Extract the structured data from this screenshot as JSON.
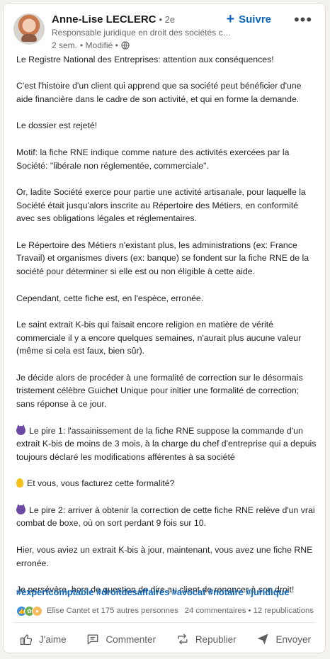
{
  "post": {
    "author_name": "Anne-Lise LECLERC",
    "degree": "• 2e",
    "headline": "Responsable juridique en droit des sociétés chez A...",
    "time": "2 sem.",
    "edited": "• Modifié •",
    "follow_label": "Suivre",
    "more_label": "•••"
  },
  "content": {
    "p1": "Le Registre National des Entreprises: attention aux conséquences!",
    "p2": "C'est l'histoire d'un client qui apprend que sa société peut bénéficier d'une aide financière dans le cadre de son activité, et qui en forme la demande.",
    "p3": "Le dossier est rejeté!",
    "p4": "Motif: la fiche RNE indique comme nature des activités exercées par la Société: \"libérale non réglementée, commerciale\".",
    "p5": "Or, ladite Société exerce pour partie une activité artisanale, pour laquelle la Société était jusqu'alors inscrite au Répertoire des Métiers, en conformité avec ses obligations légales et réglementaires.",
    "p6": "Le Répertoire des Métiers n'existant plus, les administrations (ex: France Travail) et organismes divers (ex: banque) se fondent sur la fiche RNE de la société pour déterminer si elle est ou non éligible à cette aide.",
    "p7": "Cependant, cette fiche est, en l'espèce, erronée.",
    "p8": "Le saint extrait K-bis qui faisait encore religion en matière de vérité commerciale il y a encore quelques semaines, n'aurait plus aucune valeur (même si cela est faux, bien sûr).",
    "p9": "Je décide alors de procéder à une formalité de correction sur le désormais tristement célèbre Guichet Unique pour initier une formalité de correction; sans réponse à ce jour.",
    "p10": "Le pire 1: l'assainissement de la fiche RNE suppose la commande d'un extrait K-bis de moins de 3 mois, à la charge du chef d'entreprise qui a depuis toujours déclaré les modifications afférentes à sa société",
    "p11": "Et vous, vous facturez cette formalité?",
    "p12": "Le pire 2: arriver à obtenir la correction de cette fiche RNE relève d'un vrai combat de boxe, où on sort perdant 9 fois sur 10.",
    "p13": "Hier, vous aviez un extrait K-bis à jour, maintenant, vous avez une fiche RNE erronée.",
    "p14": "Je persévère, hors de question de dire au client de renoncer à son droit!",
    "hashtags": "#expertcomptable #droitdesaffaires #avocat #notaire #juridique"
  },
  "social": {
    "reactors": "Elise Cantet et 175 autres personnes",
    "stats": "24 commentaires • 12 republications"
  },
  "actions": {
    "like": "J'aime",
    "comment": "Commenter",
    "repost": "Republier",
    "send": "Envoyer"
  },
  "colors": {
    "accent": "#0a66c2",
    "background": "#f3f2ef",
    "card": "#ffffff"
  },
  "icons": [
    "globe-icon",
    "plus-icon",
    "more-icon",
    "devil-emoji-icon",
    "bulb-emoji-icon",
    "like-icon",
    "celebrate-icon",
    "insight-icon",
    "thumbs-up-icon",
    "comment-icon",
    "repost-icon",
    "send-icon"
  ]
}
